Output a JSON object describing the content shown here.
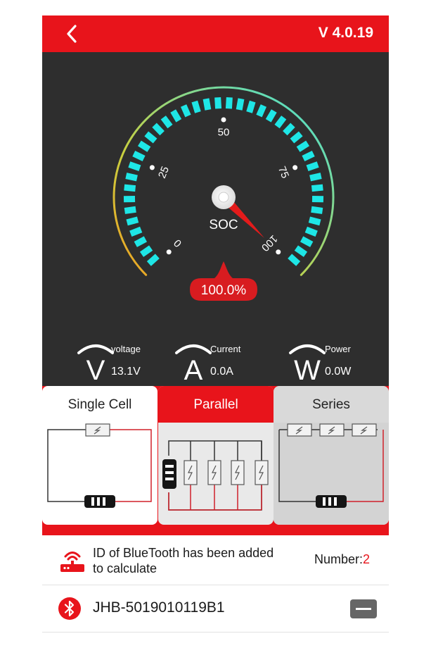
{
  "header": {
    "version": "V 4.0.19"
  },
  "gauge": {
    "center_label": "SOC",
    "soc_value": 100,
    "readout": "100.0%",
    "ticks": [
      "0",
      "25",
      "50",
      "75",
      "100"
    ],
    "colors": {
      "segment": "#1ee6e6",
      "needle": "#e31b1b",
      "arc_start": "#f0a020",
      "arc_end": "#3ee0e0"
    }
  },
  "metrics": {
    "voltage": {
      "letter": "V",
      "label": "voltage",
      "value": "13.1V"
    },
    "current": {
      "letter": "A",
      "label": "Current",
      "value": "0.0A"
    },
    "power": {
      "letter": "W",
      "label": "Power",
      "value": "0.0W"
    }
  },
  "modes": [
    {
      "id": "single",
      "label": "Single Cell",
      "selected": false
    },
    {
      "id": "parallel",
      "label": "Parallel",
      "selected": true
    },
    {
      "id": "series",
      "label": "Series",
      "selected": false
    }
  ],
  "bluetooth": {
    "message": "ID of BlueTooth has been added to calculate",
    "number_label": "Number:",
    "number_value": "2"
  },
  "devices": [
    {
      "name": "JHB-5019010119B1"
    }
  ],
  "colors": {
    "accent": "#e8141b",
    "panel": "#2e2e2e"
  }
}
